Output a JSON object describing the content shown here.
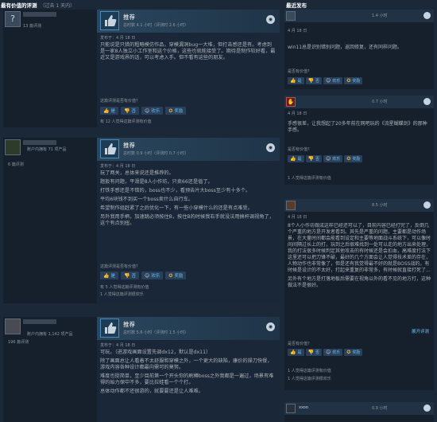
{
  "headers": {
    "left_title": "最有价值的评测",
    "left_sub": "（过去 1 天内）",
    "right_title": "最近发布"
  },
  "left_reviews": [
    {
      "author_stats": "",
      "author_reviews": "13 篇评测",
      "verdict": "推荐",
      "hours": "总时数 4.1 小时（评测时 2.6 小时）",
      "posted": "发布于：4 月 18 日",
      "paragraphs": [
        "只能说是只猎的粗略模仿作品，穿模漏洞bug一大堆，但打击感还是有。考虑到是一家8人独立小工作室和这个价格，这些也就能接受了。期待是制作较好看，最近又是游戏界的话，可以考虑入手。但不看有这些的朋友。"
      ],
      "helpful_q": "这篇评测是否有价值？",
      "buttons": [
        "是",
        "否",
        "欢乐",
        "奖励"
      ],
      "stat": "有 12 人觉得这篇评测有价值"
    },
    {
      "author_stats": "账户内拥有 71 项产品",
      "author_reviews": "6 篇评测",
      "verdict": "推荐",
      "hours": "总时数 0.9 小时（评测时 0.7 小时）",
      "posted": "发布于：4 月 18 日",
      "paragraphs": [
        "玩了两关，总体来说还是推荐的。",
        "题扳有问题，平滑是8人小作坊，只卖66还是值了。",
        "打铁手感还是不错的，boss也不少，看预告片大boss至少有十多个。",
        "平均6块钱不到买一个boss卖什么自行车。",
        "希望制作组赶紧了之后优化一下，有一些小穿模什么的还是有点难受。",
        "另外我用手柄，加速跳必须按住B，按住B的时候我右手就没法用搞杆调视角了，这个有点别扭。"
      ],
      "helpful_q": "这篇评测是否有价值？",
      "buttons": [
        "是",
        "否",
        "欢乐",
        "奖励"
      ],
      "stat": "有 5 人觉得这篇评测有价值",
      "stat2": "1 人觉得这篇评测很欢乐"
    },
    {
      "author_stats": "账户内拥有 1,142 项产品",
      "author_reviews": "196 篇评测",
      "verdict": "推荐",
      "hours": "总时数 5.6 小时（评测时 1.5 小时）",
      "posted": "发布于：4 月 18 日",
      "paragraphs": [
        "可玩。（进游戏画面设置先调dx12，默认是dx11）",
        "除了画面总让人看着不太舒服和穿模之外，一个更大的缺陷，康价的操刀快餐，游戏内容各种设计都最向需可的莫努。",
        "难度也挺简单，至少目前第一个开头你的刷樽boss之外我都是一遍过，场景有难得的始力保中不多，要比拉蛙看一个个打。",
        "总体动作都不还很游的，就要要还是让人难难。"
      ]
    }
  ],
  "right_reviews": [
    {
      "thumb": "up",
      "hours": "1.4 小时",
      "date": "4 月 18 日",
      "paragraphs": [
        "win11总是识别错别问题，返回修复，还有同样问题。"
      ],
      "helpful_q": "是否有价值？",
      "buttons": [
        "是",
        "否",
        "欢乐",
        "奖励"
      ]
    },
    {
      "thumb": "down",
      "hours": "0.7 小时",
      "date": "4 月 18 日",
      "paragraphs": [
        "手感很差，让我想起了20多年前在网吧玩的《流星蝴蝶剑》的那种手感。"
      ],
      "helpful_q": "是否有价值？",
      "buttons": [
        "是",
        "否",
        "欢乐",
        "奖励"
      ],
      "stat": "1 人觉得这篇评测有价值"
    },
    {
      "thumb": "up",
      "hours": "8.5 小时",
      "date": "4 月 18 日",
      "paragraphs": [
        "8个人小作坊做成这样已经还可以了，目前内容已经打完了，反倒几个严重的地方是开发者看到。其先是严重的问题，主要都是动作场景，在大量时间都会能看到设定和主要等地面战斗系统下，可以像时间间隔过长上的打，玩到之后很难找到一处可以走的地方出来处理，我的打法很多时候判定其他攻击的有时候还是会扣血，高难度打法下这里还可以把刀锋不破，最好的几个方面会让人觉得技术差的存在，人物动作也非常像了，但是还有我觉得最不好的就是BOSS战的，有时候是设计的不太好，打起来重复的非常多，有时候就直接打死了...",
        "另外有个地方是打落地板后需要在视角以外的看不见的地方打，这种做法不是很好。"
      ],
      "expand": "展开评测",
      "helpful_q": "是否有价值？",
      "buttons": [
        "是",
        "否",
        "欢乐",
        "奖励"
      ],
      "stat": "1 人觉得这篇评测有价值",
      "stat2": "1 人觉得这篇评测很欢乐"
    },
    {
      "thumb": "up",
      "author": "xxoo",
      "hours": "0.9 小时"
    }
  ]
}
